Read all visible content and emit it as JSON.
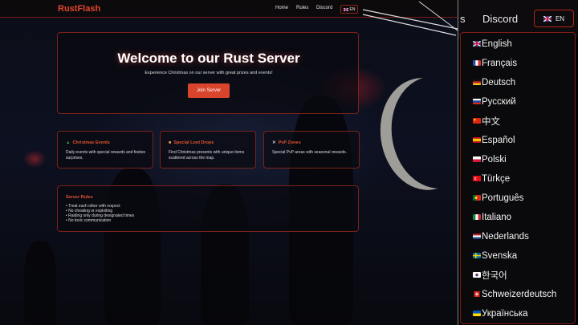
{
  "navbar": {
    "logo": "RustFlash",
    "links": [
      "Home",
      "Rules",
      "Discord"
    ],
    "lang_label": "EN"
  },
  "hero": {
    "title": "Welcome to our Rust Server",
    "subtitle": "Experience Christmas on our server with great prizes and events!",
    "button": "Join Server"
  },
  "features": [
    {
      "icon": "tree-icon",
      "title": "Christmas Events",
      "desc": "Daily events with special rewards and festive surprises."
    },
    {
      "icon": "gift-icon",
      "title": "Special Loot Drops",
      "desc": "Find Christmas presents with unique items scattered across the map."
    },
    {
      "icon": "swords-icon",
      "title": "PvP Zones",
      "desc": "Special PvP areas with seasonal rewards."
    }
  ],
  "rules": {
    "title": "Server Rules",
    "items": [
      "Treat each other with respect",
      "No cheating or exploiting",
      "Raiding only during designated times",
      "No toxic communication"
    ]
  },
  "zoom": {
    "partial_text": "s",
    "discord": "Discord",
    "lang_label": "EN",
    "languages": [
      "English",
      "Français",
      "Deutsch",
      "Русский",
      "中文",
      "Español",
      "Polski",
      "Türkçe",
      "Português",
      "Italiano",
      "Nederlands",
      "Svenska",
      "한국어",
      "Schweizerdeutsch",
      "Українська"
    ]
  },
  "colors": {
    "accent": "#e3452e",
    "border": "#7b2218"
  }
}
